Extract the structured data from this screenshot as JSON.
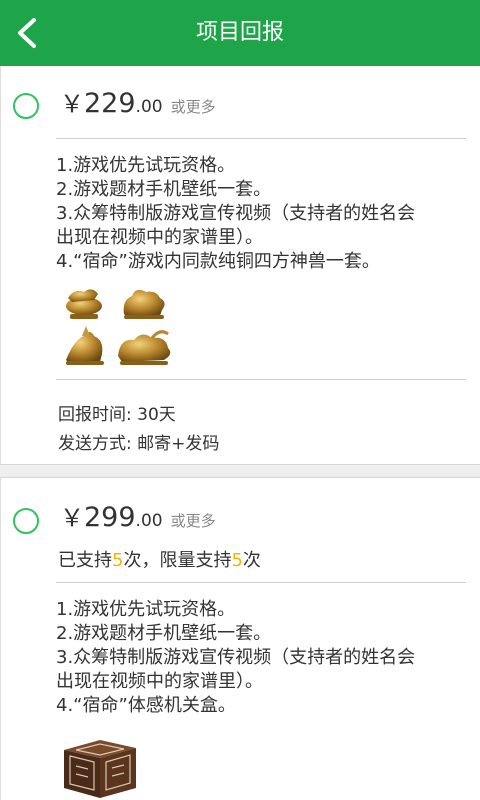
{
  "header": {
    "title": "项目回报",
    "back_icon": "chevron-left-icon",
    "background_color": "#1ea54a"
  },
  "rewards": [
    {
      "currency": "￥",
      "price_int": "229",
      "price_dec": ".00",
      "price_suffix": "或更多",
      "items": [
        "1.游戏优先试玩资格。",
        "2.游戏题材手机壁纸一套。",
        "3.众筹特制版游戏宣传视频（支持者的姓名会",
        "出现在视频中的家谱里）。",
        "4.“宿命”游戏内同款纯铜四方神兽一套。"
      ],
      "image": "bronze-beasts-image",
      "delivery_time": "回报时间: 30天",
      "delivery_method": "发送方式: 邮寄+发码"
    },
    {
      "currency": "￥",
      "price_int": "299",
      "price_dec": ".00",
      "price_suffix": "或更多",
      "support_prefix": "已支持",
      "support_count": "5",
      "support_mid": "次，限量支持",
      "limit_count": "5",
      "support_suffix": "次",
      "items": [
        "1.游戏优先试玩资格。",
        "2.游戏题材手机壁纸一套。",
        "3.众筹特制版游戏宣传视频（支持者的姓名会",
        "出现在视频中的家谱里）。",
        "4.“宿命”体感机关盒。"
      ],
      "image": "puzzle-box-image"
    }
  ],
  "colors": {
    "accent_green": "#1ea54a",
    "radio_green": "#2ec45e",
    "highlight_yellow": "#f5b400"
  }
}
